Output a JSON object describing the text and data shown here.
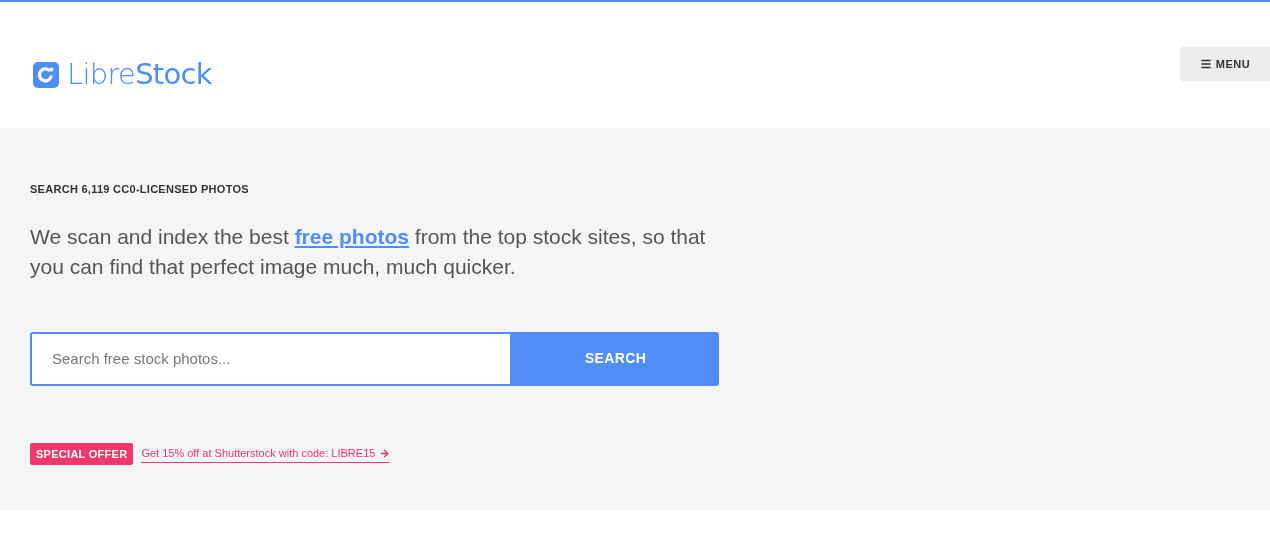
{
  "header": {
    "logo": "Libre**Stock**",
    "menu_button": "MENU"
  },
  "hero": {
    "eyebrow": "SEARCH 6,119 CC0-LICENSED PHOTOS",
    "intro": {
      "before": "We scan and index the best ",
      "link": "free photos",
      "after": " from the top stock sites, so that you can find that perfect image much, much quicker."
    },
    "search": {
      "placeholder": "Search free stock photos...",
      "button": "SEARCH"
    },
    "offer": {
      "badge": "SPECIAL OFFER",
      "link": "Get 15% off at Shutterstock with code: LIBRE15"
    }
  }
}
